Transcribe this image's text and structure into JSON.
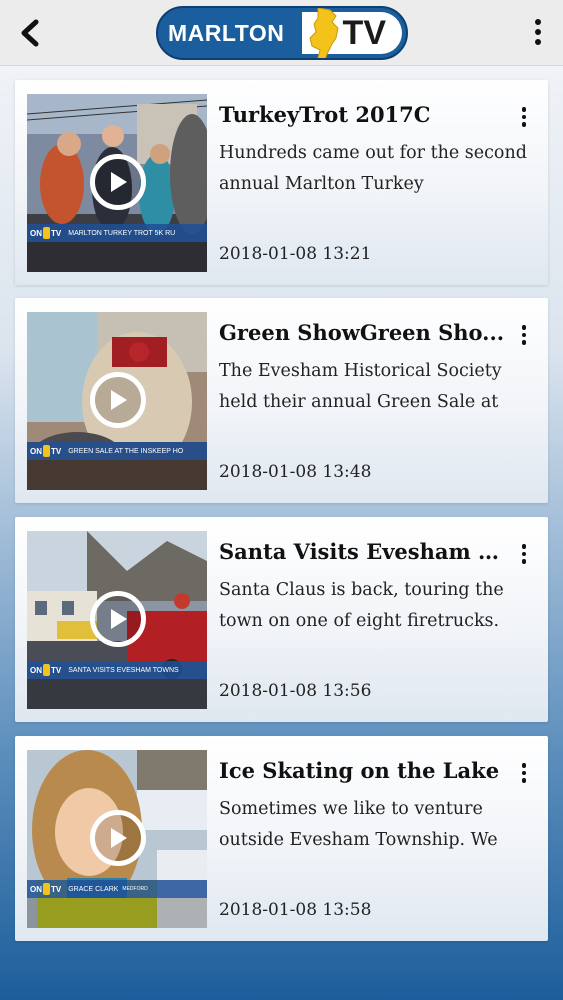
{
  "app": {
    "logo_text_left": "MARLTON",
    "logo_text_right": "TV",
    "back_icon": "chevron-left-icon",
    "menu_icon": "more-vertical-icon",
    "colors": {
      "brand_blue": "#1b5e9d",
      "brand_yellow": "#f3c21b",
      "topbar_bg": "#ececec"
    }
  },
  "videos": [
    {
      "title": "TurkeyTrot 2017C",
      "description": "Hundreds came out for the second annual Marlton Turkey",
      "date": "2018-01-08 13:21",
      "ticker": "MARLTON TURKEY TROT 5K RU",
      "ticker_logo": "ON TV"
    },
    {
      "title": "Green ShowGreen Sho...",
      "description": "The Evesham Historical Society held their annual Green Sale at",
      "date": "2018-01-08 13:48",
      "ticker": "GREEN SALE AT THE INSKEEP HO",
      "ticker_logo": "ON TV"
    },
    {
      "title": "Santa Visits Evesham T...",
      "description": "Santa Claus is back, touring the town on one of eight firetrucks.",
      "date": "2018-01-08 13:56",
      "ticker": "SANTA VISITS EVESHAM TOWNS",
      "ticker_logo": "ON TV"
    },
    {
      "title": "Ice Skating on the Lake",
      "description": "Sometimes we like to venture outside Evesham Township. We",
      "date": "2018-01-08 13:58",
      "ticker": "GRACE CLARK",
      "ticker_sub": "MEDFORD",
      "ticker_logo": "ON TV"
    }
  ]
}
